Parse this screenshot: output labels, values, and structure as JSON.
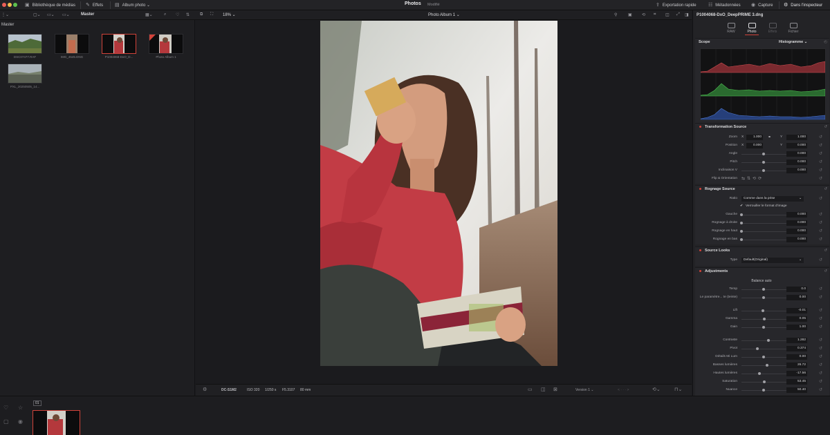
{
  "topbar": {
    "media_library": "Bibliothèque de médias",
    "effects": "Effets",
    "photo_album": "Album photo",
    "page_title": "Photos",
    "page_subtitle": "Modifié",
    "quick_export": "Exportation rapide",
    "metadata": "Métadonnées",
    "capture": "Capture",
    "in_inspector": "Dans l'inspecteur"
  },
  "toolbar2": {
    "bin_label": "Master",
    "zoom": "18%",
    "album_name": "Photo Album 1"
  },
  "media": {
    "root_label": "Master",
    "items": [
      {
        "label": "DSC07477.RAF"
      },
      {
        "label": "IMG_4545.DNG"
      },
      {
        "label": "P1004068-DxO_D..."
      },
      {
        "label": "Photo Album 1"
      },
      {
        "label": "PXL_20250505_14..."
      }
    ]
  },
  "viewerbar": {
    "camera": "DC-S1M2",
    "iso": "ISO 320",
    "shutter": "1/250 s",
    "aperture": "F5.3107",
    "focal": "80 mm",
    "version": "Version 1"
  },
  "inspector": {
    "filename": "P1004068-DxO_DeepPRIME 3.dng",
    "tabs": [
      "RAW",
      "Photo",
      "Effets",
      "Fichier"
    ],
    "scope": {
      "title": "Scope",
      "mode": "Histogramme",
      "ticks": [
        "0",
        "128",
        "256",
        "384",
        "512",
        "640",
        "768",
        "896",
        "1023"
      ]
    },
    "transform": {
      "title": "Transformation Source",
      "zoom_label": "Zoom",
      "zoom_x": "1.000",
      "zoom_y": "1.000",
      "position_label": "Position",
      "pos_x": "0.000",
      "pos_y": "0.000",
      "angle_label": "Angle",
      "angle": "0.000",
      "pitch_label": "Pitch",
      "pitch": "0.000",
      "incl_label": "Inclinaison V",
      "incl": "0.000",
      "flip_label": "Flip & Orientation",
      "x": "X",
      "y": "Y"
    },
    "crop": {
      "title": "Rognage Source",
      "ratio_label": "Ratio",
      "ratio_value": "Comme dans la prise",
      "lock_label": "Verrouiller le format d'image",
      "left_label": "Gauche",
      "left": "0.000",
      "right_label": "Rognage à droite",
      "right": "0.000",
      "top_label": "Rognage en haut",
      "top": "0.000",
      "bottom_label": "Rognage en bas",
      "bottom": "0.000"
    },
    "looks": {
      "title": "Source Looks",
      "type_label": "Type",
      "type_value": "Default(Original)"
    },
    "adjust": {
      "title": "Adjustments",
      "auto": "Balance auto",
      "temp_label": "Temp",
      "temp": "0.0",
      "tint_label": "Le paramètre... te (teinte)",
      "tint": "0.00",
      "lift_label": "Lift",
      "lift": "-0.01",
      "gamma_label": "Gamma",
      "gamma": "0.05",
      "gain_label": "Gain",
      "gain": "1.00",
      "contrast_label": "Contraste",
      "contrast": "1.282",
      "pivot_label": "Pivot",
      "pivot": "0.374",
      "detail_label": "Détails Mi Lum",
      "detail": "0.00",
      "shadows_label": "Basses lumières",
      "shadows": "26.72",
      "highlights_label": "Hautes lumières",
      "highlights": "-17.56",
      "saturation_label": "Saturation",
      "saturation": "53.45",
      "hue_label": "Nuance",
      "hue": "50.40"
    }
  },
  "bottom": {
    "clip_number": "01"
  },
  "colors": {
    "accent": "#d2433a",
    "panel": "#232326",
    "bg": "#1b1b1e",
    "tick": "#e8a33b"
  }
}
